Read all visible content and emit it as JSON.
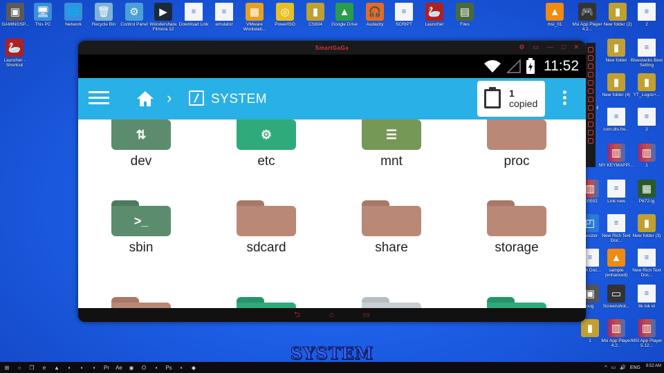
{
  "desktop": {
    "top_row": [
      {
        "label": "GAMINGSP...",
        "icon": "app-icon",
        "color": "#5a5a5a",
        "glyph": "▣"
      },
      {
        "label": "This PC",
        "icon": "computer-icon",
        "color": "#3a8fd8",
        "glyph": "🖥"
      },
      {
        "label": "Network",
        "icon": "network-icon",
        "color": "#3a8fd8",
        "glyph": "🌐"
      },
      {
        "label": "Recycle Bin",
        "icon": "recycle-bin-icon",
        "color": "#7fb3d8",
        "glyph": "🗑"
      },
      {
        "label": "Control Panel",
        "icon": "control-panel-icon",
        "color": "#4aa0d8",
        "glyph": "⚙"
      },
      {
        "label": "Wondershare Filmora 12",
        "icon": "filmora-icon",
        "color": "#1b2a3a",
        "glyph": "▶"
      },
      {
        "label": "Download Link",
        "icon": "document-icon",
        "color": "#f5f5f5",
        "glyph": "≡"
      },
      {
        "label": "emulator",
        "icon": "document-icon",
        "color": "#f5f5f5",
        "glyph": "≡"
      },
      {
        "label": "VMware Workstati...",
        "icon": "vmware-icon",
        "color": "#e8a020",
        "glyph": "▦"
      },
      {
        "label": "PowerISO",
        "icon": "poweriso-icon",
        "color": "#e8c020",
        "glyph": "◎"
      },
      {
        "label": "CS604",
        "icon": "book-icon",
        "color": "#c0a030",
        "glyph": "▮"
      },
      {
        "label": "Google Drive",
        "icon": "google-drive-icon",
        "color": "#2a9d4a",
        "glyph": "▲"
      },
      {
        "label": "Audacity",
        "icon": "audacity-icon",
        "color": "#e86a20",
        "glyph": "🎧"
      },
      {
        "label": "SCRIPT",
        "icon": "document-icon",
        "color": "#f5f5f5",
        "glyph": "≡"
      },
      {
        "label": "Launcher",
        "icon": "launcher-icon",
        "color": "#b02020",
        "glyph": "🦢"
      },
      {
        "label": "Files",
        "icon": "files-icon",
        "color": "#4a6a3a",
        "glyph": "▤"
      }
    ],
    "left_col": [
      {
        "label": "Launcher - Shortcut",
        "icon": "launcher-icon",
        "color": "#b02020",
        "glyph": "🦢"
      }
    ],
    "right_top": [
      {
        "label": "msi_01",
        "icon": "vlc-icon",
        "color": "#f08a10",
        "glyph": "▲"
      },
      {
        "label": "Msi App Player 4.2...",
        "icon": "msi-app-player-icon",
        "color": "#333",
        "glyph": "🎮"
      },
      {
        "label": "New folder (2)",
        "icon": "book-icon",
        "color": "#c0a030",
        "glyph": "▮"
      },
      {
        "label": "2",
        "icon": "document-icon",
        "color": "#f5f5f5",
        "glyph": "≡"
      }
    ],
    "right_col": [
      {
        "label": "New folder",
        "icon": "book-icon",
        "color": "#c0a030",
        "glyph": "▮"
      },
      {
        "label": "Bluestacks Best Setting",
        "icon": "document-icon",
        "color": "#f5f5f5",
        "glyph": "≡"
      },
      {
        "label": "New folder (4)",
        "icon": "book-icon",
        "color": "#c0a030",
        "glyph": "▮"
      },
      {
        "label": "YT_Logos+...",
        "icon": "book-icon",
        "color": "#c0a030",
        "glyph": "▮"
      },
      {
        "label": "com.dts.fre...",
        "icon": "document-icon",
        "color": "#f5f5f5",
        "glyph": "≡"
      },
      {
        "label": "2",
        "icon": "document-icon",
        "color": "#f5f5f5",
        "glyph": "≡"
      },
      {
        "label": "MY KEYMAPPI...",
        "icon": "winrar-icon",
        "color": "#8b2c7c",
        "glyph": "▥"
      },
      {
        "label": "1",
        "icon": "winrar-icon",
        "color": "#8b2c7c",
        "glyph": "▥"
      },
      {
        "label": "200502",
        "icon": "winrar-icon",
        "color": "#8b2c7c",
        "glyph": "▥"
      },
      {
        "label": "Link new",
        "icon": "document-icon",
        "color": "#f5f5f5",
        "glyph": "≡"
      },
      {
        "label": "P672-lg",
        "icon": "hardware-icon",
        "color": "#2a5a2a",
        "glyph": "▦"
      },
      {
        "label": "Resizer",
        "icon": "resizer-icon",
        "color": "#2a7ad8",
        "glyph": "◰"
      },
      {
        "label": "New Rich Text Doc...",
        "icon": "document-icon",
        "color": "#f5f5f5",
        "glyph": "≡"
      },
      {
        "label": "New folder (3)",
        "icon": "book-icon",
        "color": "#c0a030",
        "glyph": "▮"
      },
      {
        "label": "Rich Doc...",
        "icon": "document-icon",
        "color": "#f5f5f5",
        "glyph": "≡"
      },
      {
        "label": "sample (enhanced)",
        "icon": "vlc-icon",
        "color": "#f08a10",
        "glyph": "▲"
      },
      {
        "label": "New Rich Text Doc...",
        "icon": "document-icon",
        "color": "#f5f5f5",
        "glyph": "≡"
      },
      {
        "label": "oug",
        "icon": "app-icon",
        "color": "#555",
        "glyph": "▣"
      },
      {
        "label": "Screenshot...",
        "icon": "screenshot-icon",
        "color": "#333",
        "glyph": "▭"
      },
      {
        "label": "tik tok id",
        "icon": "document-icon",
        "color": "#f5f5f5",
        "glyph": "≡"
      },
      {
        "label": "1",
        "icon": "book-icon",
        "color": "#c0a030",
        "glyph": "▮"
      },
      {
        "label": "Msi App Player 4.2...",
        "icon": "winrar-icon",
        "color": "#8b2c7c",
        "glyph": "▥"
      },
      {
        "label": "MSI App Player 5.12...",
        "icon": "winrar-icon",
        "color": "#8b2c7c",
        "glyph": "▥"
      }
    ]
  },
  "emulator": {
    "brand": "SmartGaGa",
    "status": {
      "time": "11:52"
    },
    "appbar": {
      "title": "SYSTEM",
      "clipboard": {
        "count": "1",
        "text": "copied"
      }
    },
    "folders": [
      {
        "name": "dev",
        "color": "#5b8c6e",
        "tab": "#4d7a5e",
        "symbol": "⇅"
      },
      {
        "name": "etc",
        "color": "#2faa7a",
        "tab": "#27936a",
        "symbol": "⚙"
      },
      {
        "name": "mnt",
        "color": "#769856",
        "tab": "#668548",
        "symbol": "☰"
      },
      {
        "name": "proc",
        "color": "#b98877",
        "tab": "#a87868",
        "symbol": ""
      },
      {
        "name": "sbin",
        "color": "#5b8c6e",
        "tab": "#4d7a5e",
        "symbol": ">_"
      },
      {
        "name": "sdcard",
        "color": "#b98877",
        "tab": "#a87868",
        "symbol": ""
      },
      {
        "name": "share",
        "color": "#b98877",
        "tab": "#a87868",
        "symbol": ""
      },
      {
        "name": "storage",
        "color": "#b98877",
        "tab": "#a87868",
        "symbol": ""
      },
      {
        "name": "",
        "color": "#b98877",
        "tab": "#a87868",
        "symbol": ""
      },
      {
        "name": "",
        "color": "#2faa7a",
        "tab": "#27936a",
        "symbol": ""
      },
      {
        "name": "",
        "color": "#c9cfd3",
        "tab": "#b7bec3",
        "symbol": ""
      },
      {
        "name": "",
        "color": "#2faa7a",
        "tab": "#27936a",
        "symbol": "#"
      }
    ]
  },
  "caption": "SYSTEM",
  "taskbar": {
    "time": "8:52 AM",
    "lang": "ENG",
    "apps": [
      "start-icon",
      "search-icon",
      "task-view-icon",
      "edge-icon",
      "vlc-icon",
      "app-icon",
      "app-icon",
      "app-icon",
      "premiere-icon",
      "after-effects-icon",
      "chrome-icon",
      "opera-icon",
      "app-icon",
      "photoshop-icon",
      "app-icon",
      "smartgaga-icon"
    ]
  }
}
